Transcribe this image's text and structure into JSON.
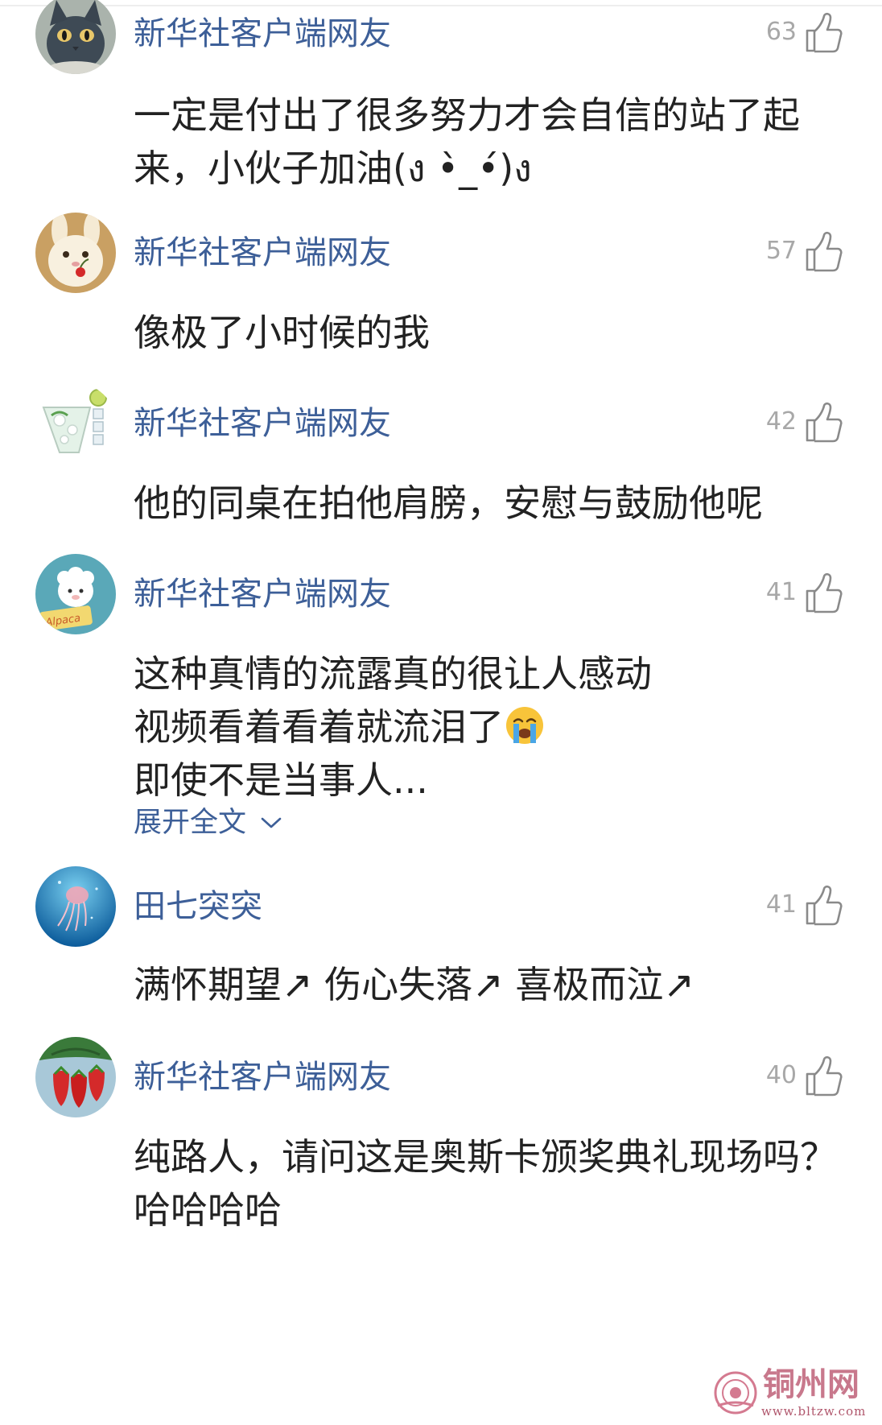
{
  "comments": [
    {
      "username": "新华社客户端网友",
      "likes": "63",
      "avatar_icon": "cat-avatar-icon",
      "lines": [
        "一定是付出了很多努力才会自信的站了起",
        "来，小伙子加油(ง •̀_•́)ง"
      ]
    },
    {
      "username": "新华社客户端网友",
      "likes": "57",
      "avatar_icon": "rabbit-avatar-icon",
      "lines": [
        "像极了小时候的我"
      ]
    },
    {
      "username": "新华社客户端网友",
      "likes": "42",
      "avatar_icon": "drink-glass-avatar-icon",
      "lines": [
        "他的同桌在拍他肩膀，安慰与鼓励他呢"
      ]
    },
    {
      "username": "新华社客户端网友",
      "likes": "41",
      "avatar_icon": "alpaca-avatar-icon",
      "lines": [
        "这种真情的流露真的很让人感动",
        "视频看着看着就流泪了",
        "即使不是当事人..."
      ],
      "emoji": "crying-face-emoji",
      "expand_label": "展开全文"
    },
    {
      "username": "田七突突",
      "likes": "41",
      "avatar_icon": "jellyfish-avatar-icon",
      "lines": [
        "满怀期望↗ 伤心失落↗ 喜极而泣↗"
      ]
    },
    {
      "username": "新华社客户端网友",
      "likes": "40",
      "avatar_icon": "strawberry-avatar-icon",
      "lines": [
        "纯路人，请问这是奥斯卡颁奖典礼现场吗？",
        "哈哈哈哈"
      ]
    }
  ],
  "watermark": {
    "name": "铜州网",
    "url": "www.bltzw.com"
  },
  "colors": {
    "username": "#3d5f98",
    "text": "#222222",
    "like_count": "#a8a8a8"
  }
}
